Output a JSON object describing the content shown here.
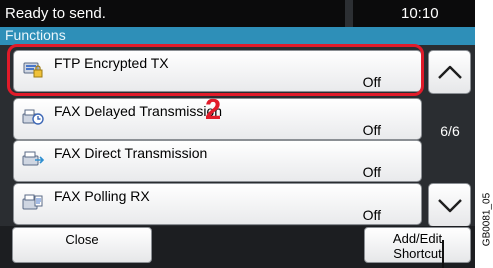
{
  "status": {
    "message": "Ready to send.",
    "time": "10:10"
  },
  "header": {
    "title": "Functions"
  },
  "items": [
    {
      "label": "FTP Encrypted TX",
      "value": "Off",
      "icon": "ftp-encrypted-icon"
    },
    {
      "label": "FAX Delayed Transmission",
      "value": "Off",
      "icon": "fax-delayed-icon"
    },
    {
      "label": "FAX Direct Transmission",
      "value": "Off",
      "icon": "fax-direct-icon"
    },
    {
      "label": "FAX Polling RX",
      "value": "Off",
      "icon": "fax-polling-icon"
    }
  ],
  "pager": {
    "indicator": "6/6"
  },
  "buttons": {
    "close": "Close",
    "shortcut_line1": "Add/Edit",
    "shortcut_line2": "Shortcut"
  },
  "annotation": {
    "step": "2",
    "figure_code": "GB0081_05"
  },
  "colors": {
    "highlight": "#e11b2a",
    "header": "#2e8fb8"
  }
}
